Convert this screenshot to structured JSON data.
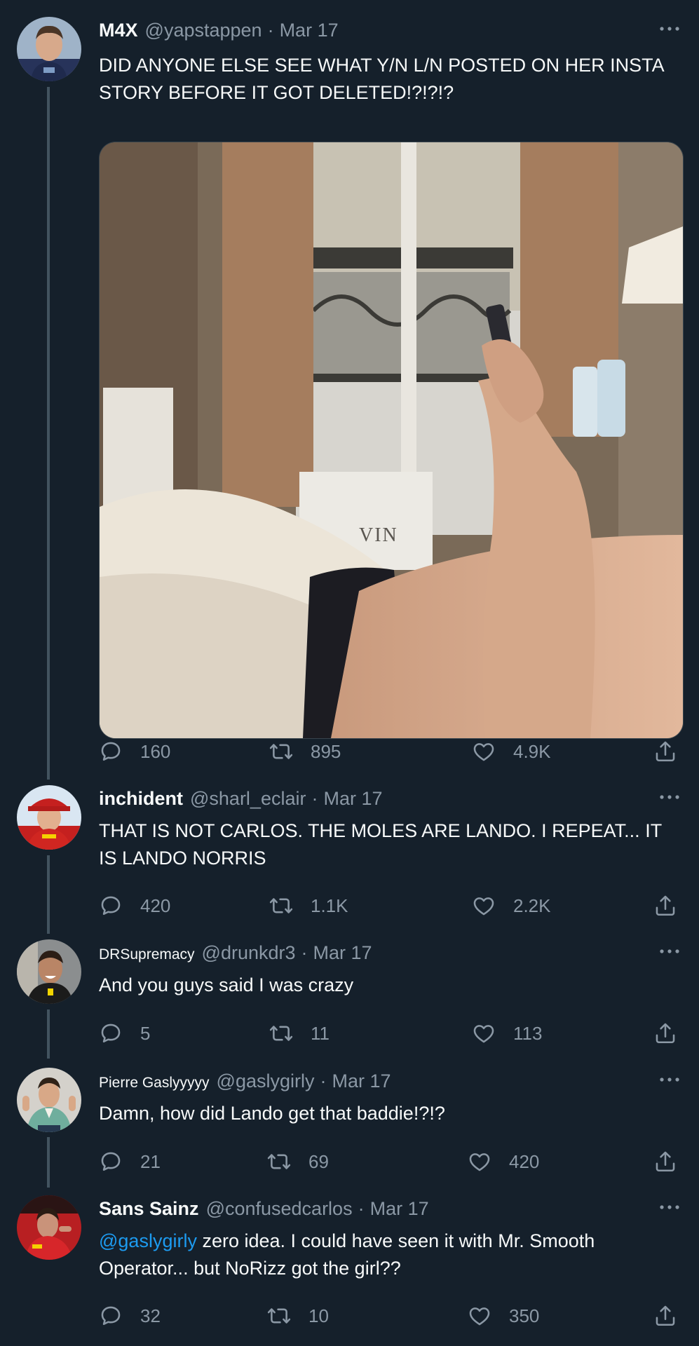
{
  "tweets": [
    {
      "display_name": "M4X",
      "handle": "@yapstappen",
      "date": "Mar 17",
      "text": "DID ANYONE ELSE SEE WHAT Y/N L/N POSTED ON HER INSTA STORY BEFORE IT GOT DELETED!?!?!?",
      "has_photo": true,
      "photo_text": "VIN",
      "replies": "160",
      "retweets": "895",
      "likes": "4.9K"
    },
    {
      "display_name": "inchident",
      "handle": "@sharl_eclair",
      "date": "Mar 17",
      "text": "THAT IS NOT CARLOS. THE MOLES ARE LANDO. I REPEAT... IT IS LANDO NORRIS",
      "replies": "420",
      "retweets": "1.1K",
      "likes": "2.2K"
    },
    {
      "display_name": "DRSupremacy",
      "handle": "@drunkdr3",
      "date": "Mar 17",
      "text": "And you guys said I was crazy",
      "replies": "5",
      "retweets": "11",
      "likes": "113"
    },
    {
      "display_name": "Pierre Gaslyyyyy",
      "handle": "@gaslygirly",
      "date": "Mar 17",
      "text": "Damn, how did Lando get that baddie!?!?",
      "replies": "21",
      "retweets": "69",
      "likes": "420"
    },
    {
      "display_name": "Sans Sainz",
      "handle": "@confusedcarlos",
      "date": "Mar 17",
      "mention": "@gaslygirly",
      "text": " zero idea. I could have seen it with Mr. Smooth Operator... but NoRizz got the girl??",
      "replies": "32",
      "retweets": "10",
      "likes": "350"
    }
  ],
  "icons": {
    "reply": "speech-bubble-icon",
    "retweet": "retweet-arrows-icon",
    "like": "heart-icon",
    "share": "share-upload-icon",
    "more": "more-dots-icon"
  },
  "colors": {
    "background": "#15202b",
    "text": "#f7f9f9",
    "muted": "#8b98a5",
    "link": "#1d9bf0",
    "thread_line": "#42535f"
  }
}
